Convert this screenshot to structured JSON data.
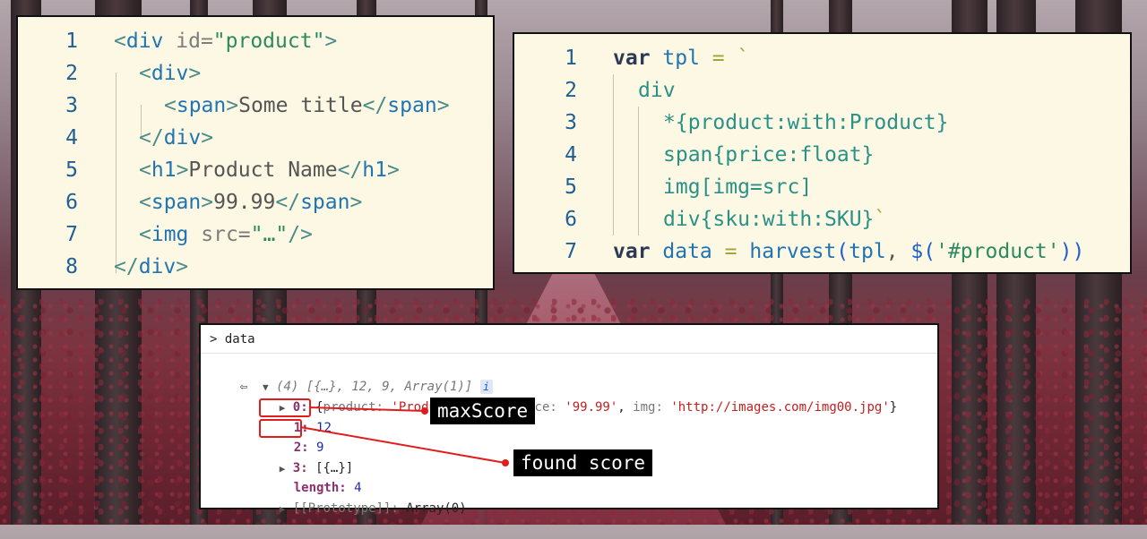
{
  "html_panel": {
    "lines": [
      {
        "num": "1",
        "parts": [
          [
            "t-bracket",
            "<"
          ],
          [
            "t-tag",
            "div "
          ],
          [
            "t-attr",
            "id="
          ],
          [
            "t-str",
            "\"product\""
          ],
          [
            "t-bracket",
            ">"
          ]
        ]
      },
      {
        "num": "2",
        "parts": [
          [
            "t-bracket",
            "<"
          ],
          [
            "t-tag",
            "div"
          ],
          [
            "t-bracket",
            ">"
          ]
        ]
      },
      {
        "num": "3",
        "parts": [
          [
            "t-bracket",
            "<"
          ],
          [
            "t-tag",
            "span"
          ],
          [
            "t-bracket",
            ">"
          ],
          [
            "t-plain",
            "Some title"
          ],
          [
            "t-bracket",
            "</"
          ],
          [
            "t-tag",
            "span"
          ],
          [
            "t-bracket",
            ">"
          ]
        ]
      },
      {
        "num": "4",
        "parts": [
          [
            "t-bracket",
            "</"
          ],
          [
            "t-tag",
            "div"
          ],
          [
            "t-bracket",
            ">"
          ]
        ]
      },
      {
        "num": "5",
        "parts": [
          [
            "t-bracket",
            "<"
          ],
          [
            "t-tag",
            "h1"
          ],
          [
            "t-bracket",
            ">"
          ],
          [
            "t-plain",
            "Product Name"
          ],
          [
            "t-bracket",
            "</"
          ],
          [
            "t-tag",
            "h1"
          ],
          [
            "t-bracket",
            ">"
          ]
        ]
      },
      {
        "num": "6",
        "parts": [
          [
            "t-bracket",
            "<"
          ],
          [
            "t-tag",
            "span"
          ],
          [
            "t-bracket",
            ">"
          ],
          [
            "t-plain",
            "99.99"
          ],
          [
            "t-bracket",
            "</"
          ],
          [
            "t-tag",
            "span"
          ],
          [
            "t-bracket",
            ">"
          ]
        ]
      },
      {
        "num": "7",
        "parts": [
          [
            "t-bracket",
            "<"
          ],
          [
            "t-tag",
            "img "
          ],
          [
            "t-attr",
            "src="
          ],
          [
            "t-str",
            "\"…\""
          ],
          [
            "t-bracket",
            "/>"
          ]
        ]
      },
      {
        "num": "8",
        "parts": [
          [
            "t-bracket",
            "</"
          ],
          [
            "t-tag",
            "div"
          ],
          [
            "t-bracket",
            ">"
          ]
        ]
      }
    ]
  },
  "js_panel": {
    "lines": [
      {
        "num": "1",
        "parts": [
          [
            "t-kw",
            "var "
          ],
          [
            "t-var",
            "tpl "
          ],
          [
            "t-op",
            "= `"
          ]
        ]
      },
      {
        "num": "2",
        "parts": [
          [
            "t-teal",
            "div"
          ]
        ]
      },
      {
        "num": "3",
        "parts": [
          [
            "t-teal",
            "*{product:with:Product}"
          ]
        ]
      },
      {
        "num": "4",
        "parts": [
          [
            "t-teal",
            "span{price:float}"
          ]
        ]
      },
      {
        "num": "5",
        "parts": [
          [
            "t-teal",
            "img[img=src]"
          ]
        ]
      },
      {
        "num": "6",
        "parts": [
          [
            "t-teal",
            "div{sku:with:SKU}"
          ],
          [
            "t-op",
            "`"
          ]
        ]
      },
      {
        "num": "7",
        "parts": [
          [
            "t-kw",
            "var "
          ],
          [
            "t-var",
            "data "
          ],
          [
            "t-op",
            "= "
          ],
          [
            "t-fn",
            "harvest"
          ],
          [
            "t-paren",
            "("
          ],
          [
            "t-var",
            "tpl"
          ],
          [
            "t-plain",
            ", "
          ],
          [
            "t-dollar",
            "$"
          ],
          [
            "t-paren",
            "("
          ],
          [
            "t-str",
            "'#product'"
          ],
          [
            "t-paren",
            "))"
          ]
        ]
      }
    ]
  },
  "console": {
    "prompt": "> data",
    "result_summary": "(4) [{…}, 12, 9, Array(1)]",
    "info_badge": "i",
    "item0_key": "0:",
    "item0_open": "{",
    "item0_product_key": "product:",
    "item0_product_val": "'Product Name'",
    "item0_price_key": "price:",
    "item0_price_val": "'99.99'",
    "item0_img_key": "img:",
    "item0_img_val": "'http://images.com/img00.jpg'",
    "item0_close": "}",
    "item1_key": "1:",
    "item1_val": "12",
    "item2_key": "2:",
    "item2_val": "9",
    "item3_key": "3:",
    "item3_val": "[{…}]",
    "length_key": "length:",
    "length_val": "4",
    "proto_key": "[[Prototype]]:",
    "proto_val": "Array(0)"
  },
  "callouts": {
    "max_score": "maxScore",
    "found_score": "found score"
  },
  "colors": {
    "panel_bg": "#fdf8e3",
    "annotation_red": "#e21c1c"
  }
}
